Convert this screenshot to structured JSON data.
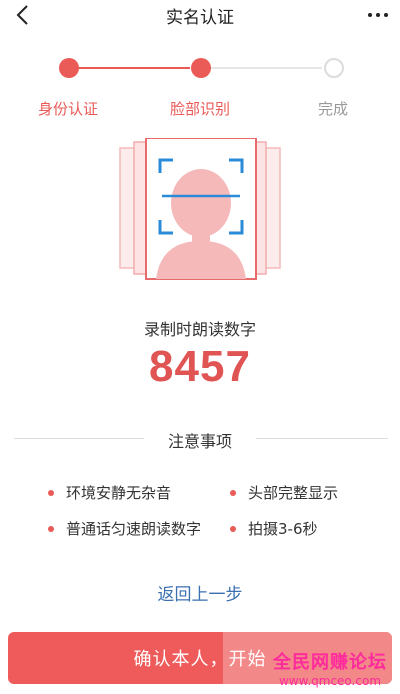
{
  "nav": {
    "title": "实名认证",
    "back_icon": "chevron-left-icon",
    "more_icon": "more-horizontal-icon"
  },
  "stepper": {
    "steps": [
      {
        "label": "身份认证",
        "state": "done"
      },
      {
        "label": "脸部识别",
        "state": "current"
      },
      {
        "label": "完成",
        "state": "todo"
      }
    ]
  },
  "record": {
    "prompt": "录制时朗读数字",
    "code": "8457"
  },
  "notes": {
    "title": "注意事项",
    "items": [
      "环境安静无杂音",
      "头部完整显示",
      "普通话匀速朗读数字",
      "拍摄3-6秒"
    ]
  },
  "back_link": "返回上一步",
  "confirm_button": "确认本人，开始",
  "watermark": {
    "text": "全民网赚论坛",
    "url": "www.qmceo.com"
  },
  "colors": {
    "accent": "#ea5a57",
    "code_red": "#e05454",
    "link_blue": "#3a6fb0",
    "scan_blue": "#2a8cd8",
    "inactive_gray": "#999999"
  }
}
